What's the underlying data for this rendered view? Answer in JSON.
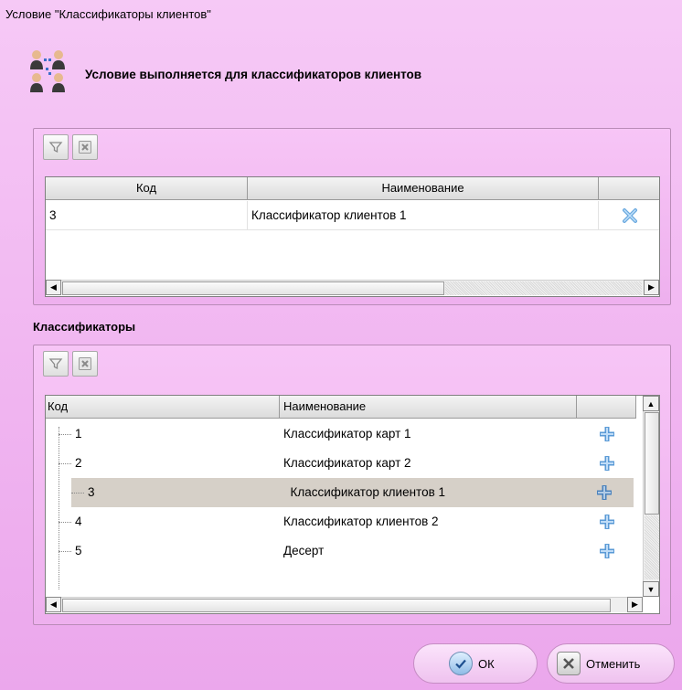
{
  "window": {
    "title": "Условие \"Классификаторы клиентов\""
  },
  "header": {
    "text": "Условие выполняется для классификаторов клиентов",
    "icon": "users-group-icon"
  },
  "selected_grid": {
    "columns": [
      "Код",
      "Наименование",
      ""
    ],
    "rows": [
      {
        "code": "3",
        "name": "Классификатор клиентов 1",
        "action_icon": "remove-x-icon"
      }
    ]
  },
  "section": {
    "label": "Классификаторы"
  },
  "classifiers_grid": {
    "columns": [
      "Код",
      "Наименование",
      ""
    ],
    "rows": [
      {
        "code": "1",
        "name": "Классификатор карт 1",
        "action_icon": "add-plus-icon"
      },
      {
        "code": "2",
        "name": "Классификатор карт 2",
        "action_icon": "add-plus-icon"
      },
      {
        "code": "3",
        "name": "Классификатор клиентов 1",
        "action_icon": "add-plus-icon",
        "selected": true
      },
      {
        "code": "4",
        "name": "Классификатор клиентов 2",
        "action_icon": "add-plus-icon"
      },
      {
        "code": "5",
        "name": "Десерт",
        "action_icon": "add-plus-icon"
      }
    ]
  },
  "buttons": {
    "ok": "ОК",
    "cancel": "Отменить"
  },
  "colors": {
    "background": "#f1b7f1",
    "selected_row": "#d6d0c8",
    "add_icon": "#5a9ad6"
  }
}
